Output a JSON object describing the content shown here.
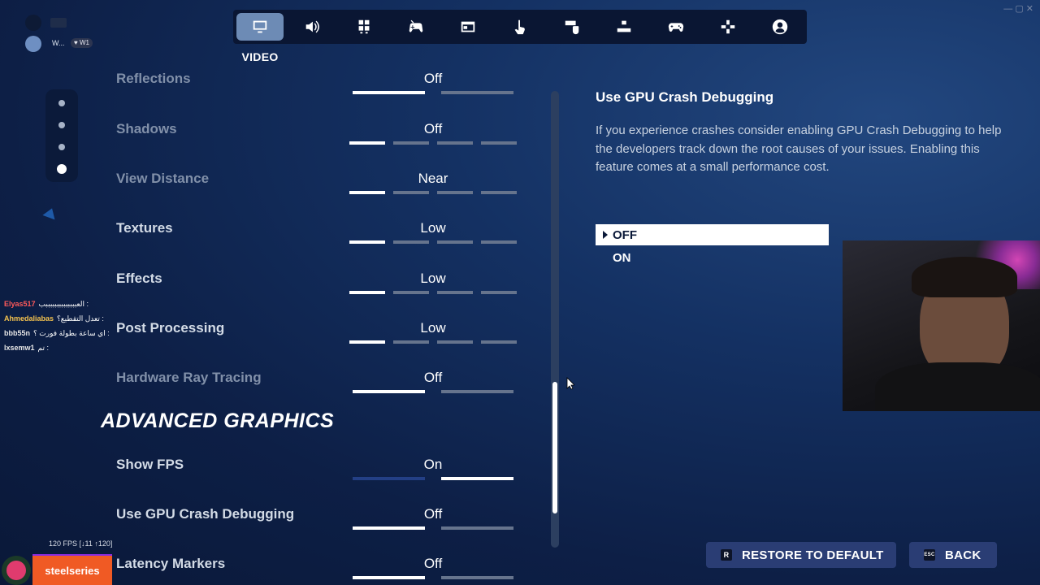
{
  "nav": {
    "active_label": "VIDEO",
    "tabs": [
      {
        "icon": "monitor-icon",
        "active": true
      },
      {
        "icon": "speaker-icon",
        "active": false
      },
      {
        "icon": "accessibility-icon",
        "active": false
      },
      {
        "icon": "controller-touch-icon",
        "active": false
      },
      {
        "icon": "game-ui-icon",
        "active": false
      },
      {
        "icon": "touch-icon",
        "active": false
      },
      {
        "icon": "keyboard-mouse-icon",
        "active": false
      },
      {
        "icon": "controls-hierarchy-icon",
        "active": false
      },
      {
        "icon": "gamepad-icon",
        "active": false
      },
      {
        "icon": "dpad-icon",
        "active": false
      },
      {
        "icon": "account-icon",
        "active": false
      }
    ]
  },
  "settings": [
    {
      "label": "Reflections",
      "value": "Off",
      "segments": 2,
      "level": 1,
      "dim": true
    },
    {
      "label": "Shadows",
      "value": "Off",
      "segments": 4,
      "level": 1,
      "dim": true
    },
    {
      "label": "View Distance",
      "value": "Near",
      "segments": 4,
      "level": 1,
      "dim": true
    },
    {
      "label": "Textures",
      "value": "Low",
      "segments": 4,
      "level": 1,
      "dim": false
    },
    {
      "label": "Effects",
      "value": "Low",
      "segments": 4,
      "level": 1,
      "dim": false
    },
    {
      "label": "Post Processing",
      "value": "Low",
      "segments": 4,
      "level": 1,
      "dim": false
    },
    {
      "label": "Hardware Ray Tracing",
      "value": "Off",
      "segments": 2,
      "level": 1,
      "dim": true
    }
  ],
  "advanced_title": "ADVANCED GRAPHICS",
  "advanced_settings": [
    {
      "label": "Show FPS",
      "value": "On",
      "segments": 2,
      "level": 2,
      "dim": false
    },
    {
      "label": "Use GPU Crash Debugging",
      "value": "Off",
      "segments": 2,
      "level": 1,
      "dim": false
    },
    {
      "label": "Latency Markers",
      "value": "Off",
      "segments": 2,
      "level": 1,
      "dim": false
    }
  ],
  "description": {
    "title": "Use GPU Crash Debugging",
    "body": "If you experience crashes consider enabling GPU Crash Debugging to help the developers track down the root causes of your issues. Enabling this feature comes at a small performance cost.",
    "options": [
      "OFF",
      "ON"
    ],
    "selected": "OFF"
  },
  "buttons": {
    "restore_key": "R",
    "restore_label": "RESTORE TO DEFAULT",
    "back_key": "ESC",
    "back_label": "BACK"
  },
  "chat": [
    {
      "name": "Elyas517",
      "msg": "العببببببببببببببب :",
      "color": "#ff5a5a"
    },
    {
      "name": "Ahmedaliabas",
      "msg": "تعدل التقطيع؟ :",
      "color": "#f2c14e"
    },
    {
      "name": "bbb55n",
      "msg": "اي ساعة بطولة فورت ؟ :",
      "color": "#e6e6e6"
    },
    {
      "name": "lxsemw1",
      "msg": "تم :",
      "color": "#e6e6e6"
    }
  ],
  "overlay": {
    "fps_text": "120 FPS [↓11 ↑120]",
    "sponsor": "steelseries",
    "profile_text": "W...",
    "profile_badge": "♥ W1"
  },
  "scroll": {
    "position": 0.78
  }
}
